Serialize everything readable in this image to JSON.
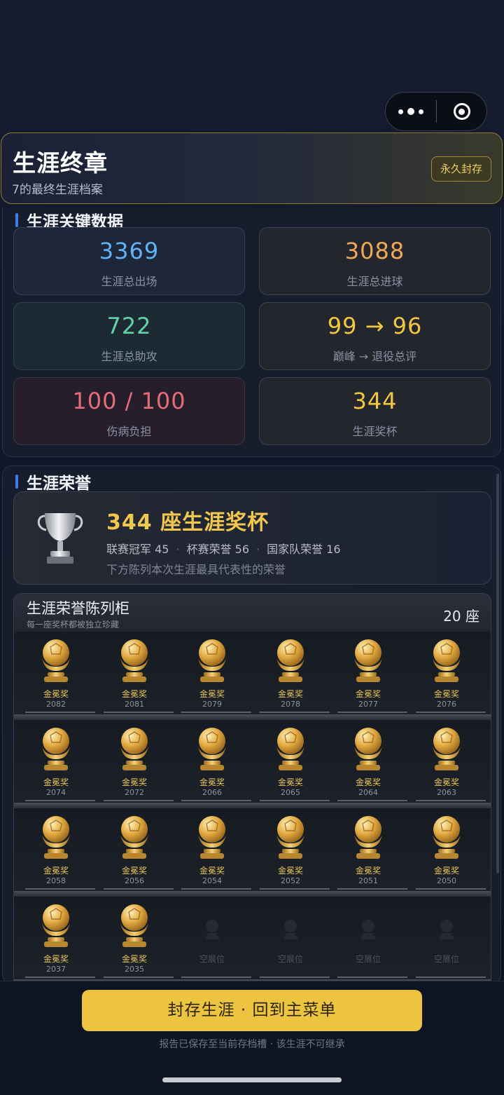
{
  "capsule": {
    "more_icon": "ellipsis-icon",
    "close_icon": "target-icon"
  },
  "header": {
    "title": "生涯终章",
    "subtitle": "7的最终生涯档案",
    "badge": "永久封存"
  },
  "key_data": {
    "title": "生涯关键数据",
    "stats": [
      {
        "value": "3369",
        "label": "生涯总出场",
        "color": "#5fb3f6"
      },
      {
        "value": "3088",
        "label": "生涯总进球",
        "color": "#f0a858"
      },
      {
        "value": "722",
        "label": "生涯总助攻",
        "color": "#5fd3a6"
      },
      {
        "value": "99 → 96",
        "label": "巅峰 → 退役总评",
        "color": "#f0c83f"
      },
      {
        "value": "100 / 100",
        "label": "伤病负担",
        "color": "#e66c78"
      },
      {
        "value": "344",
        "label": "生涯奖杯",
        "color": "#f0c83f"
      }
    ]
  },
  "honors": {
    "title": "生涯荣誉",
    "trophy_title": "344 座生涯奖杯",
    "league_label": "联赛冠军",
    "league_count": "45",
    "cup_label": "杯赛荣誉",
    "cup_count": "56",
    "national_label": "国家队荣誉",
    "national_count": "16",
    "note": "下方陈列本次生涯最具代表性的荣誉"
  },
  "cabinet": {
    "title": "生涯荣誉陈列柜",
    "subtitle": "每一座奖杯都被独立珍藏",
    "count": "20 座",
    "rows": [
      [
        {
          "name": "金冕奖",
          "year": "2082"
        },
        {
          "name": "金冕奖",
          "year": "2081"
        },
        {
          "name": "金冕奖",
          "year": "2079"
        },
        {
          "name": "金冕奖",
          "year": "2078"
        },
        {
          "name": "金冕奖",
          "year": "2077"
        },
        {
          "name": "金冕奖",
          "year": "2076"
        }
      ],
      [
        {
          "name": "金冕奖",
          "year": "2074"
        },
        {
          "name": "金冕奖",
          "year": "2072"
        },
        {
          "name": "金冕奖",
          "year": "2066"
        },
        {
          "name": "金冕奖",
          "year": "2065"
        },
        {
          "name": "金冕奖",
          "year": "2064"
        },
        {
          "name": "金冕奖",
          "year": "2063"
        }
      ],
      [
        {
          "name": "金冕奖",
          "year": "2058"
        },
        {
          "name": "金冕奖",
          "year": "2056"
        },
        {
          "name": "金冕奖",
          "year": "2054"
        },
        {
          "name": "金冕奖",
          "year": "2052"
        },
        {
          "name": "金冕奖",
          "year": "2051"
        },
        {
          "name": "金冕奖",
          "year": "2050"
        }
      ],
      [
        {
          "name": "金冕奖",
          "year": "2037"
        },
        {
          "name": "金冕奖",
          "year": "2035"
        },
        {
          "name": "空展位",
          "year": ""
        },
        {
          "name": "空展位",
          "year": ""
        },
        {
          "name": "空展位",
          "year": ""
        },
        {
          "name": "空展位",
          "year": ""
        }
      ]
    ]
  },
  "footer": {
    "button": "封存生涯 · 回到主菜单",
    "note": "报告已保存至当前存档槽 · 该生涯不可继承"
  }
}
